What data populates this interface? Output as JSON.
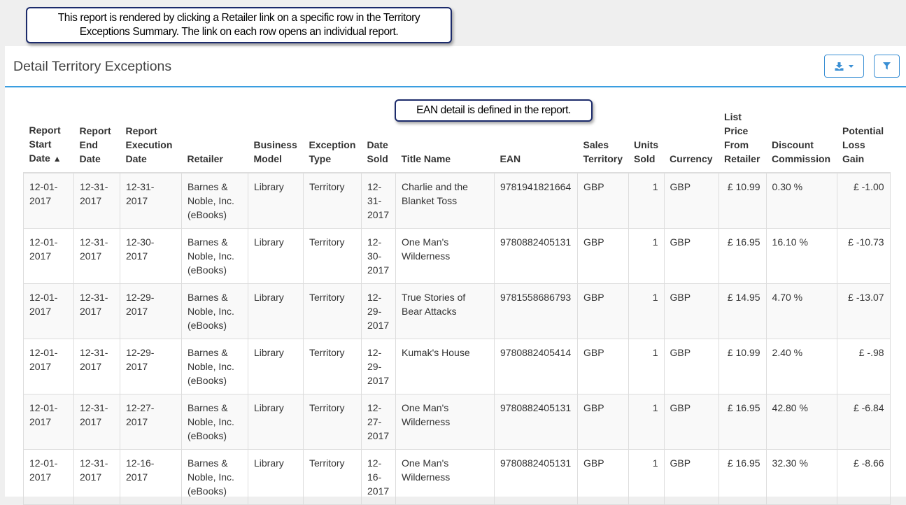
{
  "callouts": {
    "top_line1": "This report is rendered by clicking a Retailer link on a specific row in the Territory",
    "top_line2": "Exceptions Summary.  The link on each row opens an individual report.",
    "ean": "EAN detail is defined in the report."
  },
  "header": {
    "title": "Detail Territory Exceptions",
    "download_icon": "download-icon",
    "filter_icon": "filter-icon",
    "accent_color": "#3a9ee0"
  },
  "table": {
    "columns": [
      [
        "Report",
        "Start",
        "Date"
      ],
      [
        "Report",
        "End",
        "Date"
      ],
      [
        "Report",
        "Execution",
        "Date"
      ],
      [
        "Retailer"
      ],
      [
        "Business",
        "Model"
      ],
      [
        "Exception",
        "Type"
      ],
      [
        "Date",
        "Sold"
      ],
      [
        "Title Name"
      ],
      [
        "EAN"
      ],
      [
        "Sales",
        "Territory"
      ],
      [
        "Units",
        "Sold"
      ],
      [
        "Currency"
      ],
      [
        "List",
        "Price",
        "From",
        "Retailer"
      ],
      [
        "Discount",
        "Commission"
      ],
      [
        "Potential",
        "Loss",
        "Gain"
      ]
    ],
    "sort_indicator": "▲",
    "rows": [
      {
        "start": [
          "12-01-",
          "2017"
        ],
        "end": [
          "12-31-",
          "2017"
        ],
        "exec": [
          "12-31-",
          "2017"
        ],
        "retailer": [
          "Barnes &",
          "Noble, Inc.",
          "(eBooks)"
        ],
        "model": "Library",
        "type": "Territory",
        "sold_date": [
          "12-",
          "31-",
          "2017"
        ],
        "title": [
          "Charlie and the",
          "Blanket Toss"
        ],
        "ean": "9781941821664",
        "territory": "GBP",
        "units": "1",
        "currency": "GBP",
        "price": "£ 10.99",
        "commission": "0.30 %",
        "loss": "£ -1.00"
      },
      {
        "start": [
          "12-01-",
          "2017"
        ],
        "end": [
          "12-31-",
          "2017"
        ],
        "exec": [
          "12-30-",
          "2017"
        ],
        "retailer": [
          "Barnes &",
          "Noble, Inc.",
          "(eBooks)"
        ],
        "model": "Library",
        "type": "Territory",
        "sold_date": [
          "12-",
          "30-",
          "2017"
        ],
        "title": [
          "One Man's",
          "Wilderness"
        ],
        "ean": "9780882405131",
        "territory": "GBP",
        "units": "1",
        "currency": "GBP",
        "price": "£ 16.95",
        "commission": "16.10 %",
        "loss": "£ -10.73"
      },
      {
        "start": [
          "12-01-",
          "2017"
        ],
        "end": [
          "12-31-",
          "2017"
        ],
        "exec": [
          "12-29-",
          "2017"
        ],
        "retailer": [
          "Barnes &",
          "Noble, Inc.",
          "(eBooks)"
        ],
        "model": "Library",
        "type": "Territory",
        "sold_date": [
          "12-",
          "29-",
          "2017"
        ],
        "title": [
          "True Stories of",
          "Bear Attacks"
        ],
        "ean": "9781558686793",
        "territory": "GBP",
        "units": "1",
        "currency": "GBP",
        "price": "£ 14.95",
        "commission": "4.70 %",
        "loss": "£ -13.07"
      },
      {
        "start": [
          "12-01-",
          "2017"
        ],
        "end": [
          "12-31-",
          "2017"
        ],
        "exec": [
          "12-29-",
          "2017"
        ],
        "retailer": [
          "Barnes &",
          "Noble, Inc.",
          "(eBooks)"
        ],
        "model": "Library",
        "type": "Territory",
        "sold_date": [
          "12-",
          "29-",
          "2017"
        ],
        "title": [
          "Kumak's House"
        ],
        "ean": "9780882405414",
        "territory": "GBP",
        "units": "1",
        "currency": "GBP",
        "price": "£ 10.99",
        "commission": "2.40 %",
        "loss": "£ -.98"
      },
      {
        "start": [
          "12-01-",
          "2017"
        ],
        "end": [
          "12-31-",
          "2017"
        ],
        "exec": [
          "12-27-",
          "2017"
        ],
        "retailer": [
          "Barnes &",
          "Noble, Inc.",
          "(eBooks)"
        ],
        "model": "Library",
        "type": "Territory",
        "sold_date": [
          "12-",
          "27-",
          "2017"
        ],
        "title": [
          "One Man's",
          "Wilderness"
        ],
        "ean": "9780882405131",
        "territory": "GBP",
        "units": "1",
        "currency": "GBP",
        "price": "£ 16.95",
        "commission": "42.80 %",
        "loss": "£ -6.84"
      },
      {
        "start": [
          "12-01-",
          "2017"
        ],
        "end": [
          "12-31-",
          "2017"
        ],
        "exec": [
          "12-16-",
          "2017"
        ],
        "retailer": [
          "Barnes &",
          "Noble, Inc.",
          "(eBooks)"
        ],
        "model": "Library",
        "type": "Territory",
        "sold_date": [
          "12-",
          "16-",
          "2017"
        ],
        "title": [
          "One Man's",
          "Wilderness"
        ],
        "ean": "9780882405131",
        "territory": "GBP",
        "units": "1",
        "currency": "GBP",
        "price": "£ 16.95",
        "commission": "32.30 %",
        "loss": "£ -8.66"
      }
    ]
  }
}
